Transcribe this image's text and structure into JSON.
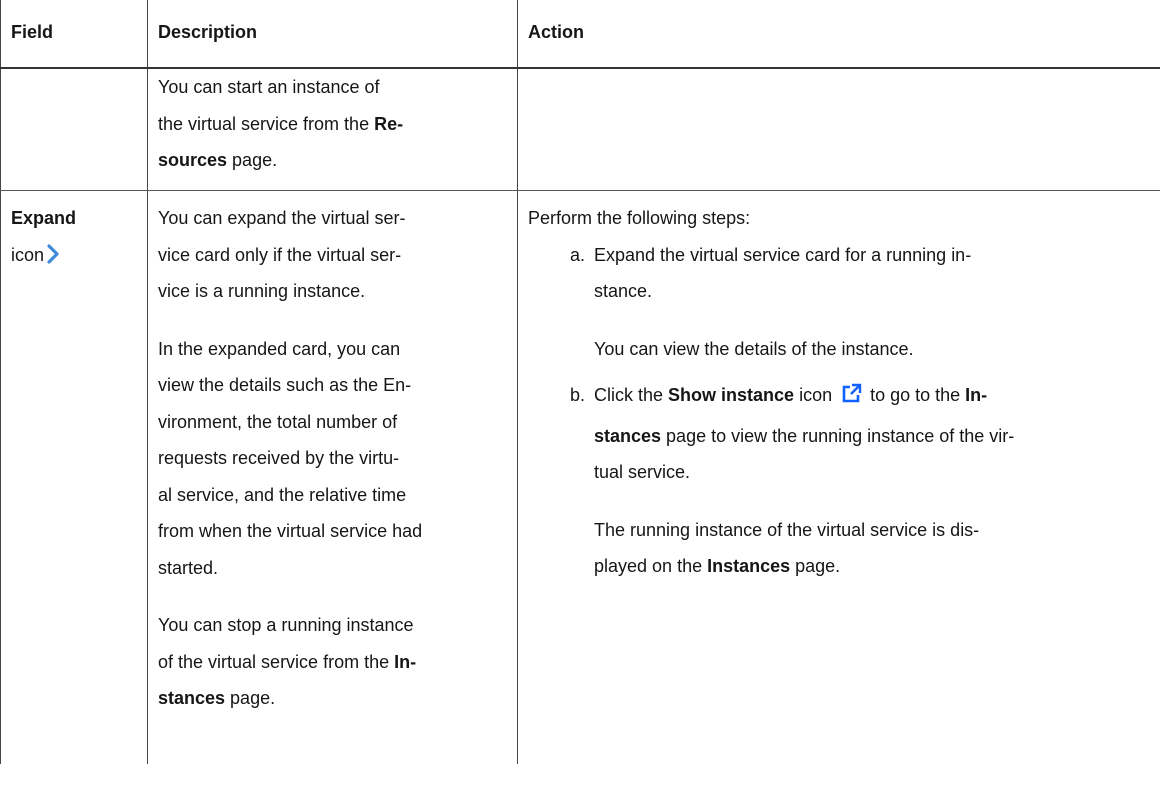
{
  "headers": {
    "field": "Field",
    "description": "Description",
    "action": "Action"
  },
  "row1": {
    "desc": {
      "a": "You can start an instance of",
      "b": "the virtual service from the ",
      "b_bold": "Re-",
      "c_bold": "sources",
      "c": " page."
    }
  },
  "row2": {
    "field": {
      "label": "Expand",
      "sub": "icon",
      "icon": "chevron-right-icon"
    },
    "desc": {
      "p1": [
        "You can expand the virtual ser-",
        "vice card only if the virtual ser-",
        "vice is a running instance."
      ],
      "p2": [
        "In the expanded card, you can",
        "view the details such as the En-",
        "vironment, the total number of",
        "requests received by the virtu-",
        "al service, and the relative time",
        "from when the virtual service had",
        "started."
      ],
      "p3": {
        "l1": "You can stop a running instance",
        "l2a": "of the virtual service from the ",
        "l2b": "In-",
        "l3a": "stances",
        "l3b": " page."
      }
    },
    "action": {
      "intro": "Perform the following steps:",
      "steps": [
        {
          "marker": "a.",
          "l1": "Expand the virtual service card for a running in-",
          "l2": "stance.",
          "result": "You can view the details of the instance."
        },
        {
          "marker": "b.",
          "l1a": "Click the ",
          "l1b": "Show instance",
          "l1c": " icon ",
          "l1d": " to go to the ",
          "l1e": "In-",
          "l2a": "stances",
          "l2b": " page to view the running instance of the vir-",
          "l3": "tual service.",
          "icon": "external-link-icon",
          "result1": "The running instance of the virtual service is dis-",
          "result2a": "played on the ",
          "result2b": "Instances",
          "result2c": " page."
        }
      ]
    }
  },
  "colors": {
    "text": "#161616",
    "icon_blue": "#0f62fe",
    "chevron": "#3d8bd9"
  }
}
